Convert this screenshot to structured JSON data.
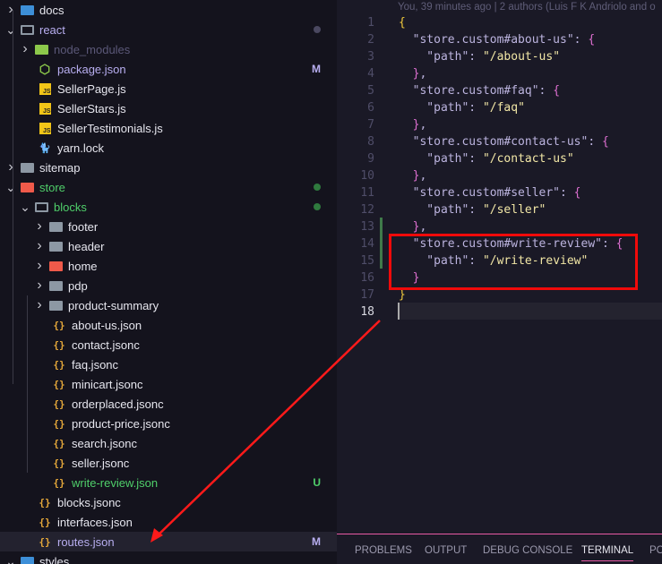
{
  "explorer": {
    "items": [
      {
        "label": "docs",
        "depth": 0,
        "type": "folder",
        "expanded": false,
        "icon": "docs-folder-icon",
        "color": "#e6e6ee"
      },
      {
        "label": "react",
        "depth": 0,
        "type": "folder",
        "expanded": true,
        "icon": "folder-open-icon",
        "color": "#b8aef0",
        "dot": "#4a4860"
      },
      {
        "label": "node_modules",
        "depth": 1,
        "type": "folder",
        "expanded": false,
        "icon": "node-folder-icon",
        "color": "#5b5878"
      },
      {
        "label": "package.json",
        "depth": 1,
        "type": "file",
        "icon": "nodejs-icon",
        "color": "#b8aef0",
        "badge": "M",
        "badge_color": "#b8aef0"
      },
      {
        "label": "SellerPage.js",
        "depth": 1,
        "type": "file",
        "icon": "js-icon"
      },
      {
        "label": "SellerStars.js",
        "depth": 1,
        "type": "file",
        "icon": "js-icon"
      },
      {
        "label": "SellerTestimonials.js",
        "depth": 1,
        "type": "file",
        "icon": "js-icon"
      },
      {
        "label": "yarn.lock",
        "depth": 1,
        "type": "file",
        "icon": "yarn-icon"
      },
      {
        "label": "sitemap",
        "depth": 0,
        "type": "folder",
        "expanded": false,
        "icon": "folder-icon"
      },
      {
        "label": "store",
        "depth": 0,
        "type": "folder",
        "expanded": true,
        "icon": "store-folder-icon",
        "color": "#4fcf6a",
        "dot": "#2f7a3e"
      },
      {
        "label": "blocks",
        "depth": 1,
        "type": "folder",
        "expanded": true,
        "icon": "folder-open-icon",
        "color": "#4fcf6a",
        "dot": "#2f7a3e"
      },
      {
        "label": "footer",
        "depth": 2,
        "type": "folder",
        "expanded": false,
        "icon": "folder-icon"
      },
      {
        "label": "header",
        "depth": 2,
        "type": "folder",
        "expanded": false,
        "icon": "folder-icon"
      },
      {
        "label": "home",
        "depth": 2,
        "type": "folder",
        "expanded": false,
        "icon": "home-folder-icon"
      },
      {
        "label": "pdp",
        "depth": 2,
        "type": "folder",
        "expanded": false,
        "icon": "folder-icon"
      },
      {
        "label": "product-summary",
        "depth": 2,
        "type": "folder",
        "expanded": false,
        "icon": "folder-icon"
      },
      {
        "label": "about-us.json",
        "depth": 2,
        "type": "file",
        "icon": "json-icon"
      },
      {
        "label": "contact.jsonc",
        "depth": 2,
        "type": "file",
        "icon": "json-icon"
      },
      {
        "label": "faq.jsonc",
        "depth": 2,
        "type": "file",
        "icon": "json-icon"
      },
      {
        "label": "minicart.jsonc",
        "depth": 2,
        "type": "file",
        "icon": "json-icon"
      },
      {
        "label": "orderplaced.jsonc",
        "depth": 2,
        "type": "file",
        "icon": "json-icon"
      },
      {
        "label": "product-price.jsonc",
        "depth": 2,
        "type": "file",
        "icon": "json-icon"
      },
      {
        "label": "search.jsonc",
        "depth": 2,
        "type": "file",
        "icon": "json-icon"
      },
      {
        "label": "seller.jsonc",
        "depth": 2,
        "type": "file",
        "icon": "json-icon"
      },
      {
        "label": "write-review.json",
        "depth": 2,
        "type": "file",
        "icon": "json-icon",
        "color": "#4fcf6a",
        "badge": "U",
        "badge_color": "#4fcf6a"
      },
      {
        "label": "blocks.jsonc",
        "depth": 1,
        "type": "file",
        "icon": "json-icon"
      },
      {
        "label": "interfaces.json",
        "depth": 1,
        "type": "file",
        "icon": "json-icon"
      },
      {
        "label": "routes.json",
        "depth": 1,
        "type": "file",
        "icon": "json-icon",
        "color": "#b8aef0",
        "badge": "M",
        "badge_color": "#b8aef0",
        "selected": true
      },
      {
        "label": "styles",
        "depth": 0,
        "type": "folder",
        "expanded": true,
        "icon": "styles-folder-icon"
      }
    ]
  },
  "editor": {
    "blame": "You, 39 minutes ago | 2 authors (Luis F K Andriolo and o",
    "current_line": 18,
    "lines": [
      [
        [
          "y",
          "{"
        ]
      ],
      [
        [
          "k",
          "  \"store.custom#about-us\""
        ],
        [
          "c",
          ": "
        ],
        [
          "p",
          "{"
        ]
      ],
      [
        [
          "k",
          "    \"path\""
        ],
        [
          "c",
          ": "
        ],
        [
          "s",
          "\"/about-us\""
        ]
      ],
      [
        [
          "p",
          "  }"
        ],
        [
          "c",
          ","
        ]
      ],
      [
        [
          "k",
          "  \"store.custom#faq\""
        ],
        [
          "c",
          ": "
        ],
        [
          "p",
          "{"
        ]
      ],
      [
        [
          "k",
          "    \"path\""
        ],
        [
          "c",
          ": "
        ],
        [
          "s",
          "\"/faq\""
        ]
      ],
      [
        [
          "p",
          "  }"
        ],
        [
          "c",
          ","
        ]
      ],
      [
        [
          "k",
          "  \"store.custom#contact-us\""
        ],
        [
          "c",
          ": "
        ],
        [
          "p",
          "{"
        ]
      ],
      [
        [
          "k",
          "    \"path\""
        ],
        [
          "c",
          ": "
        ],
        [
          "s",
          "\"/contact-us\""
        ]
      ],
      [
        [
          "p",
          "  }"
        ],
        [
          "c",
          ","
        ]
      ],
      [
        [
          "k",
          "  \"store.custom#seller\""
        ],
        [
          "c",
          ": "
        ],
        [
          "p",
          "{"
        ]
      ],
      [
        [
          "k",
          "    \"path\""
        ],
        [
          "c",
          ": "
        ],
        [
          "s",
          "\"/seller\""
        ]
      ],
      [
        [
          "p",
          "  }"
        ],
        [
          "c",
          ","
        ]
      ],
      [
        [
          "k",
          "  \"store.custom#write-review\""
        ],
        [
          "c",
          ": "
        ],
        [
          "p",
          "{"
        ]
      ],
      [
        [
          "k",
          "    \"path\""
        ],
        [
          "c",
          ": "
        ],
        [
          "s",
          "\"/write-review\""
        ]
      ],
      [
        [
          "p",
          "  }"
        ]
      ],
      [
        [
          "y",
          "}"
        ]
      ],
      []
    ]
  },
  "panel": {
    "tabs": [
      "PROBLEMS",
      "OUTPUT",
      "DEBUG CONSOLE",
      "TERMINAL",
      "PO"
    ],
    "active": "TERMINAL"
  },
  "annotation_color": "#ff1a1a"
}
